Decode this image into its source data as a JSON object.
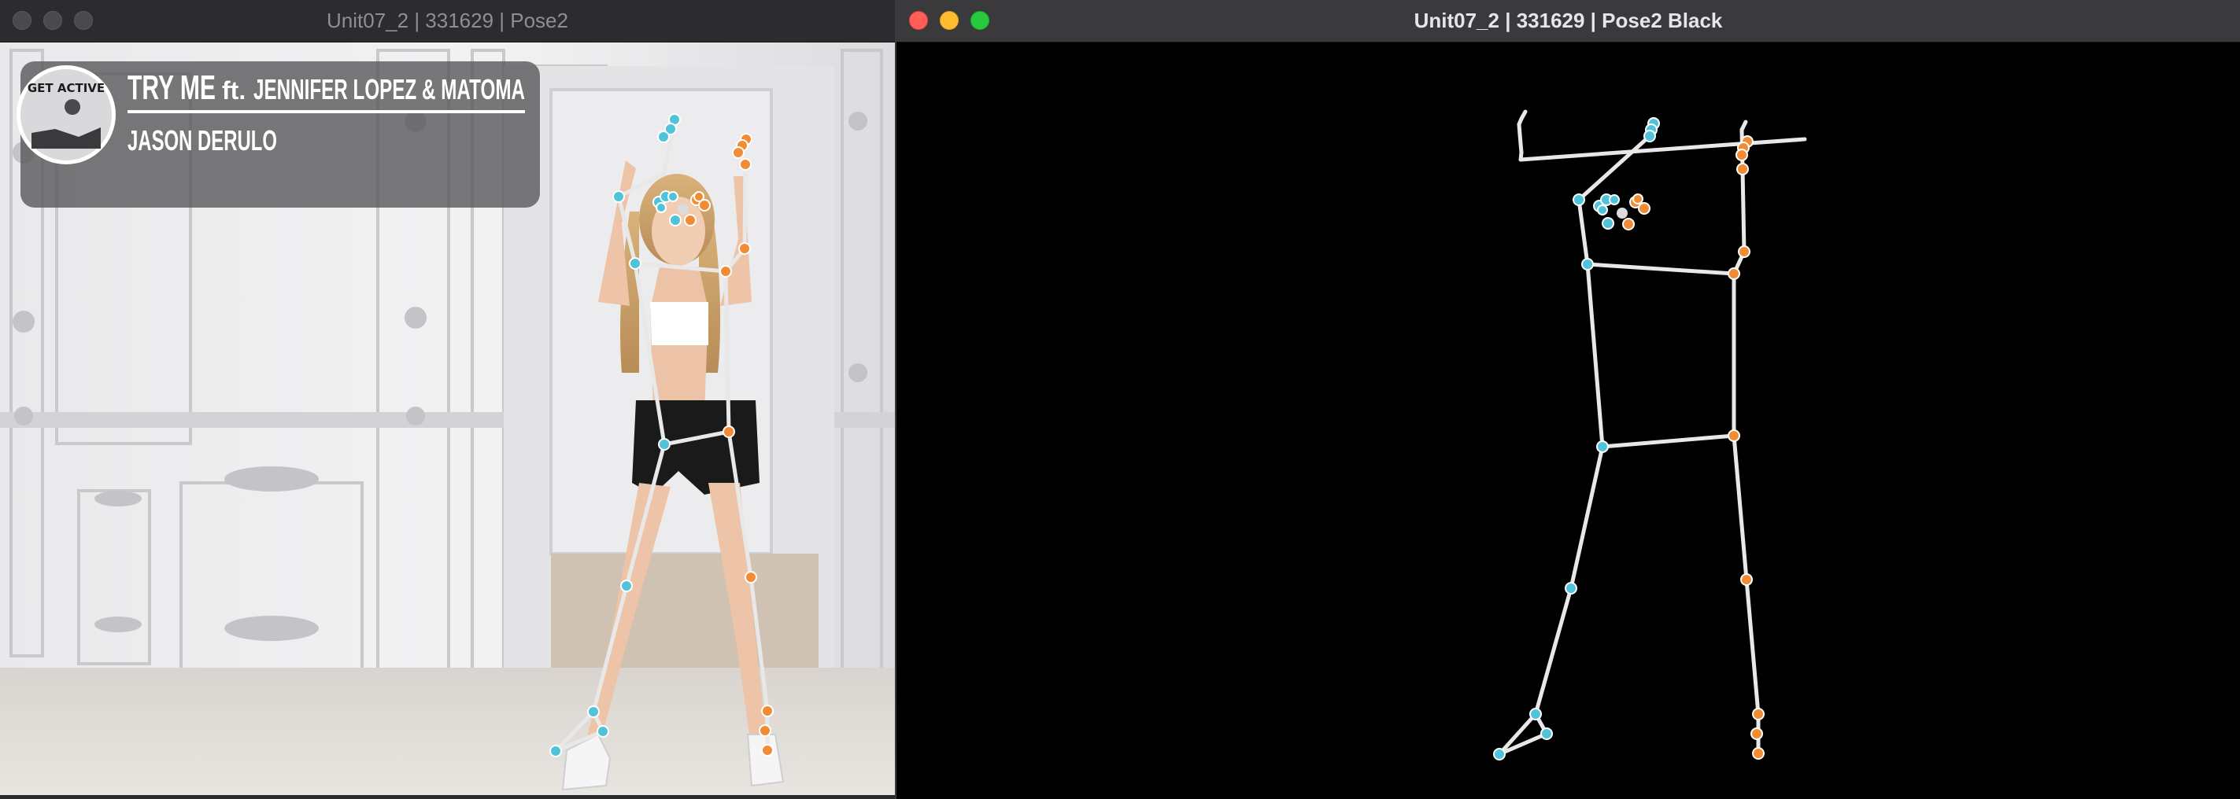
{
  "windows": {
    "left": {
      "title": "Unit07_2 | 331629 | Pose2",
      "traffic_lights": "inactive"
    },
    "right": {
      "title": "Unit07_2 | 331629 | Pose2 Black",
      "traffic_lights": "active"
    }
  },
  "video_overlay": {
    "badge_text": "GET ACTIVE",
    "song_title": "TRY ME",
    "featuring": "ft.",
    "artists": "JENNIFER LOPEZ & MATOMA",
    "main_artist": "JASON DERULO"
  },
  "colors": {
    "left_keypoint": "#4fc3d9",
    "right_keypoint": "#f28c34",
    "bone": "#e8e8e8",
    "canvas": "#000000"
  },
  "icons": [
    "window-close-icon",
    "window-minimize-icon",
    "window-maximize-icon"
  ]
}
